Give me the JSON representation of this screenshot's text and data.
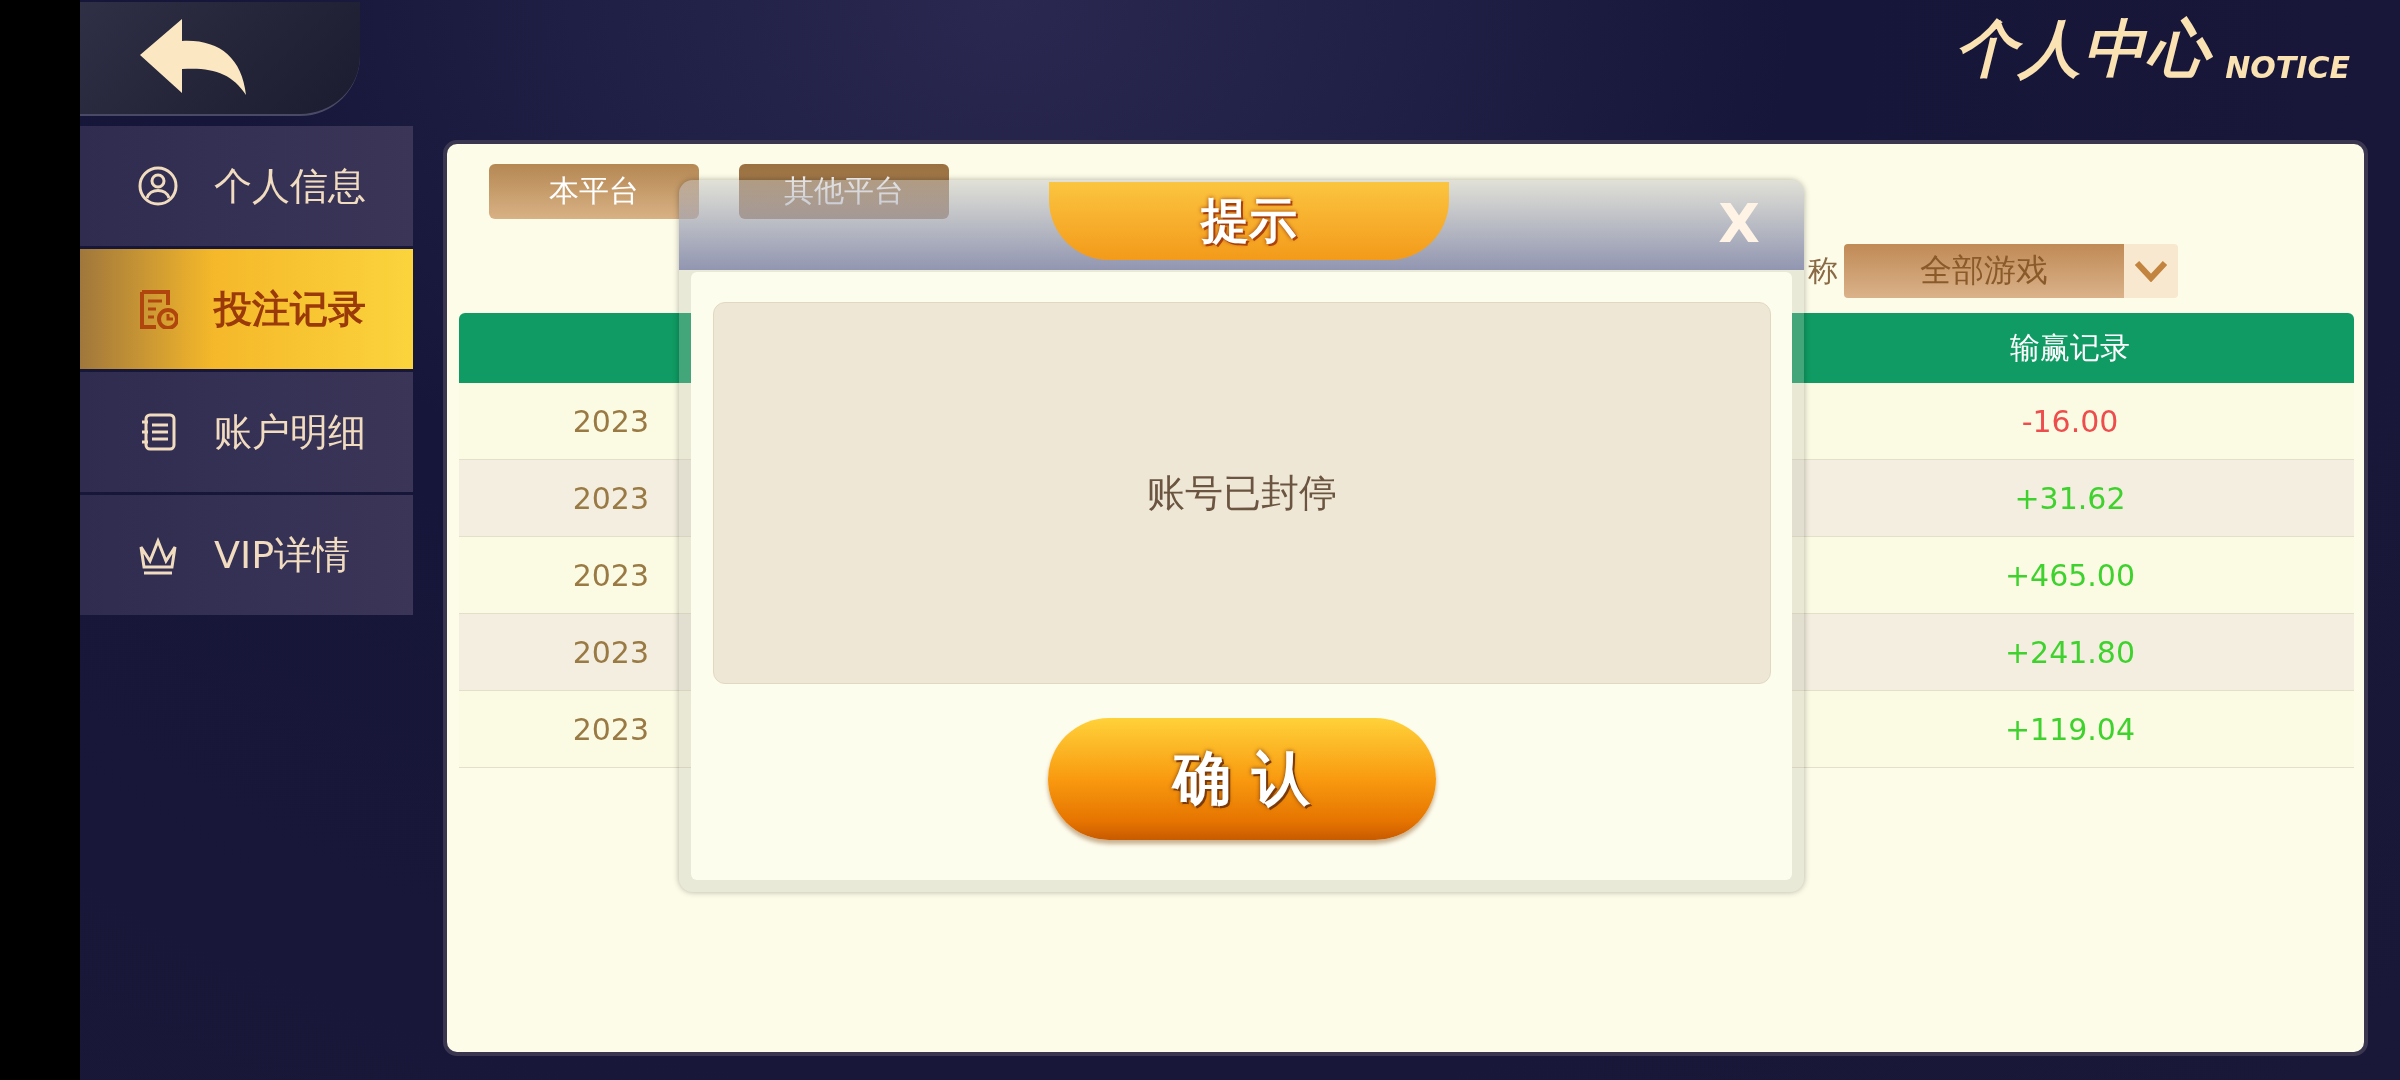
{
  "header": {
    "back": true,
    "title": "个人中心",
    "subtitle": "NOTICE"
  },
  "sidebar": {
    "items": [
      {
        "label": "个人信息",
        "selected": false
      },
      {
        "label": "投注记录",
        "selected": true
      },
      {
        "label": "账户明细",
        "selected": false
      },
      {
        "label": "VIP详情",
        "selected": false
      }
    ]
  },
  "tabs": [
    {
      "label": "本平台",
      "selected": true
    },
    {
      "label": "其他平台",
      "selected": false
    }
  ],
  "filter": {
    "label": "称",
    "value": "全部游戏"
  },
  "table": {
    "columns": [
      "输赢记录"
    ],
    "rows": [
      {
        "date": "2023",
        "result": "-16.00",
        "kind": "loss"
      },
      {
        "date": "2023",
        "result": "+31.62",
        "kind": "win"
      },
      {
        "date": "2023",
        "result": "+465.00",
        "kind": "win"
      },
      {
        "date": "2023",
        "result": "+241.80",
        "kind": "win"
      },
      {
        "date": "2023",
        "result": "+119.04",
        "kind": "win"
      }
    ]
  },
  "dialog": {
    "title": "提示",
    "close": "X",
    "message": "账号已封停",
    "button": "确  认"
  }
}
